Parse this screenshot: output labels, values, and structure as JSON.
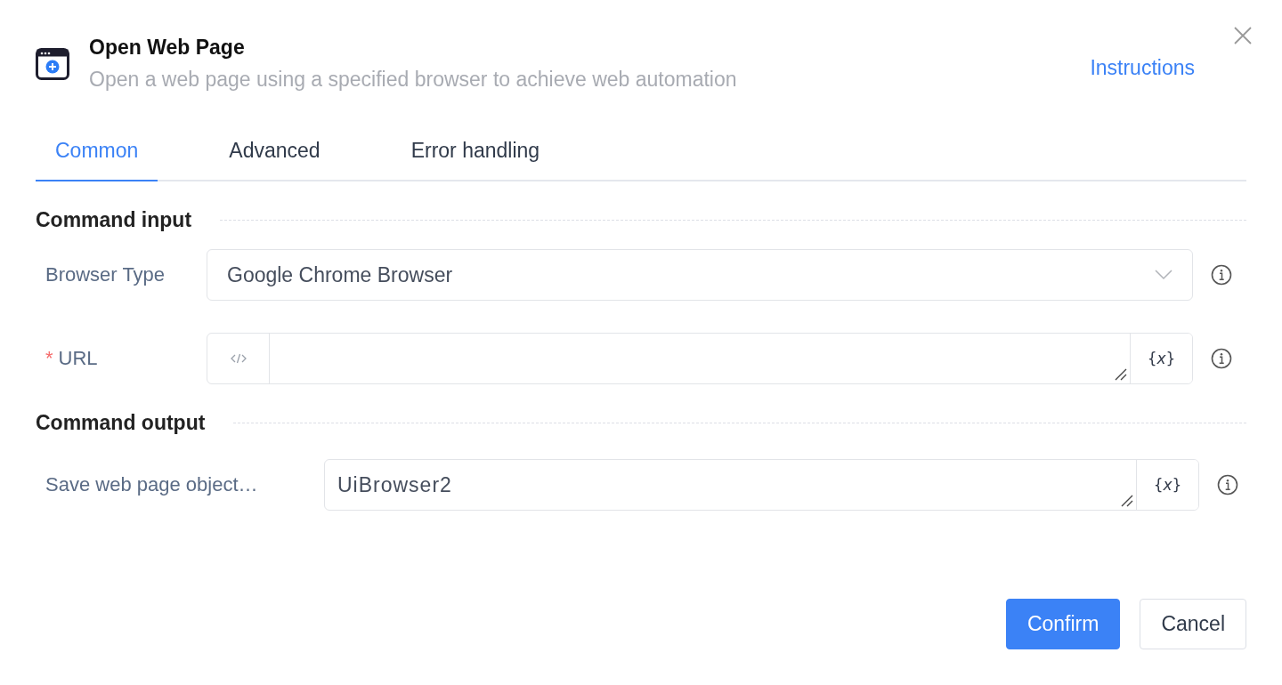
{
  "dialog": {
    "title": "Open Web Page",
    "subtitle": "Open a web page using a specified browser to achieve web automation",
    "instructions_link": "Instructions"
  },
  "tabs": [
    {
      "label": "Common",
      "selected": true
    },
    {
      "label": "Advanced",
      "selected": false
    },
    {
      "label": "Error handling",
      "selected": false
    }
  ],
  "sections": [
    {
      "title": "Command input",
      "fields": [
        {
          "kind": "select",
          "label": "Browser Type",
          "value": "Google Chrome Browser"
        },
        {
          "kind": "expression",
          "label": "URL",
          "required_mark": "*",
          "variable_button": "{*x*}"
        }
      ]
    },
    {
      "title": "Command output",
      "fields": [
        {
          "kind": "variable",
          "label": "Save web page object…",
          "value": "UiBrowser2",
          "variable_button": "{*x*}"
        }
      ]
    }
  ],
  "buttons": [
    {
      "label": "Confirm",
      "primary": true
    },
    {
      "label": "Cancel",
      "primary": false
    }
  ]
}
